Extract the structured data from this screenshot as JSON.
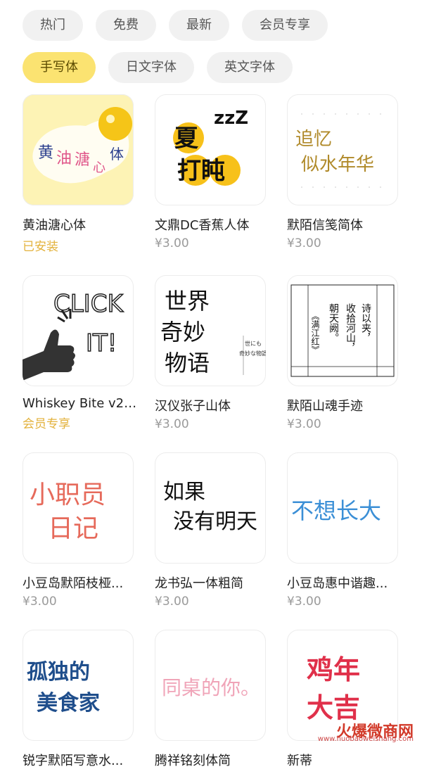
{
  "filters_row1": [
    "热门",
    "免费",
    "最新",
    "会员专享"
  ],
  "filters_row2": [
    "手写体",
    "日文字体",
    "英文字体"
  ],
  "active_filter": "手写体",
  "fonts": [
    {
      "name": "黄油溏心体",
      "sub": "已安装",
      "thumb_text": [
        "黄",
        "油",
        "溏",
        "心",
        "体"
      ]
    },
    {
      "name": "文鼎DC香蕉人体",
      "sub": "¥3.00",
      "thumb_text": [
        "夏",
        "zzZ",
        "打盹"
      ]
    },
    {
      "name": "默陌信笺简体",
      "sub": "¥3.00",
      "thumb_text": [
        "追忆",
        "似水年华"
      ]
    },
    {
      "name": "Whiskey Bite v2 ...",
      "sub": "会员专享",
      "thumb_text": [
        "CLICK",
        "IT!"
      ]
    },
    {
      "name": "汉仪张子山体",
      "sub": "¥3.00",
      "thumb_text": [
        "世界",
        "奇妙",
        "物语",
        "世にも",
        "奇妙な物語"
      ]
    },
    {
      "name": "默陌山魂手迹",
      "sub": "¥3.00",
      "thumb_text": [
        "诗以夹，",
        "收拾河山，",
        "朝天阙。",
        "《满江红》"
      ]
    },
    {
      "name": "小豆岛默陌枝桠...",
      "sub": "¥3.00",
      "thumb_text": [
        "小职员",
        "日记"
      ]
    },
    {
      "name": "龙书弘一体粗简",
      "sub": "¥3.00",
      "thumb_text": [
        "如果",
        "没有明天"
      ]
    },
    {
      "name": "小豆岛惠中谐趣...",
      "sub": "¥3.00",
      "thumb_text": [
        "不想长大"
      ]
    },
    {
      "name": "锐字默陌写意水...",
      "sub": "",
      "thumb_text": [
        "孤独的",
        "美食家"
      ]
    },
    {
      "name": "腾祥铭刻体简",
      "sub": "",
      "thumb_text": [
        "同桌的你。"
      ]
    },
    {
      "name": "新蒂",
      "sub": "",
      "thumb_text": [
        "鸡年",
        "大吉"
      ]
    }
  ],
  "watermark": {
    "main": "火爆微商网",
    "url": "www.huobaoweishang.com"
  },
  "colors": {
    "accent": "#fbe371",
    "installed": "#e3b23c",
    "price": "#9a9a9a"
  }
}
